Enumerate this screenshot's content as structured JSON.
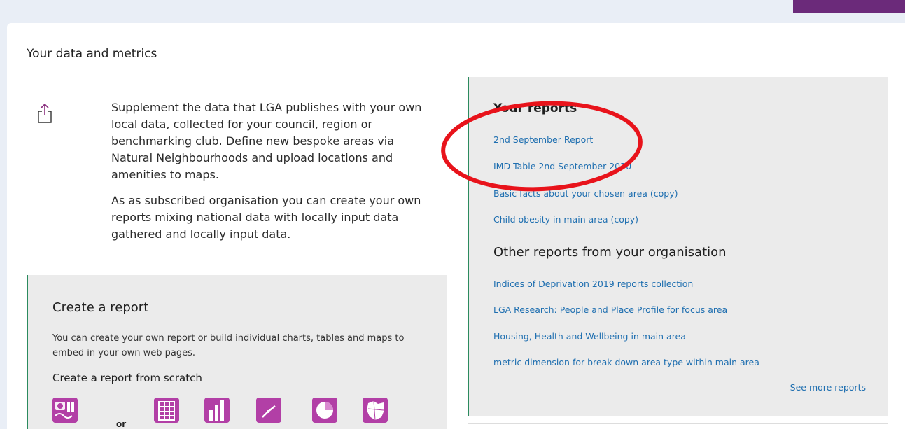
{
  "colors": {
    "accent_purple": "#6b2a7a",
    "tile_magenta": "#b23fa6",
    "link_blue": "#1f6fb0",
    "border_green": "#2b8a5e",
    "annotation_red": "#e8131b"
  },
  "page": {
    "section_title": "Your data and metrics"
  },
  "intro": {
    "icon": "upload-icon",
    "paragraph1": "Supplement the data that LGA publishes with your own local data, collected for your council, region or benchmarking club. Define new bespoke areas via Natural Neighbourhoods and upload locations and amenities to maps.",
    "paragraph2": "As as subscribed organisation you can create your own reports mixing national data with locally input data gathered and locally input data."
  },
  "create_report": {
    "title": "Create a report",
    "description": "You can create your own report or build individual charts, tables and maps to embed in your own web pages.",
    "subtitle": "Create a report from scratch",
    "or_label": "or",
    "tiles": [
      "report-template-icon",
      "table-icon",
      "bar-chart-icon",
      "line-chart-icon",
      "pie-chart-icon",
      "map-icon"
    ]
  },
  "your_reports": {
    "title": "Your reports",
    "items": [
      "2nd September Report",
      "IMD Table 2nd September 2020",
      "Basic facts about your chosen area (copy)",
      "Child obesity in main area (copy)"
    ]
  },
  "other_reports": {
    "title": "Other reports from your organisation",
    "items": [
      "Indices of Deprivation 2019 reports collection",
      "LGA Research: People and Place Profile for focus area",
      "Housing, Health and Wellbeing in main area",
      "metric dimension for break down area type within main area"
    ],
    "see_more": "See more reports"
  }
}
